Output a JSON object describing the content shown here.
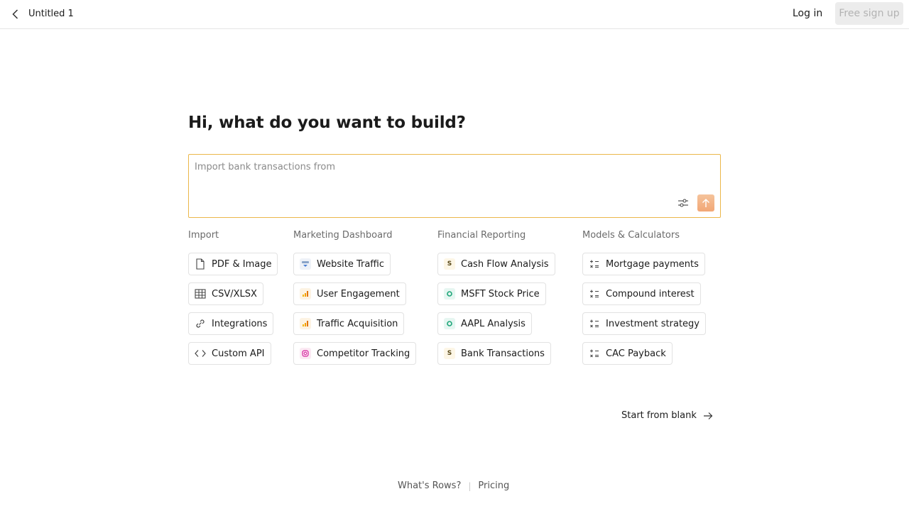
{
  "header": {
    "back_icon": "chevron-left-icon",
    "doc_title": "Untitled 1",
    "login_label": "Log in",
    "signup_label": "Free sign up"
  },
  "main": {
    "heading": "Hi, what do you want to build?",
    "prompt_placeholder": "Import bank transactions from",
    "accent_color": "#ebb74a"
  },
  "columns": [
    {
      "title": "Import",
      "items": [
        {
          "label": "PDF & Image",
          "icon": "document-icon"
        },
        {
          "label": "CSV/XLSX",
          "icon": "table-icon"
        },
        {
          "label": "Integrations",
          "icon": "link-icon"
        },
        {
          "label": "Custom API",
          "icon": "code-icon"
        }
      ]
    },
    {
      "title": "Marketing Dashboard",
      "items": [
        {
          "label": "Website Traffic",
          "icon": "search-console-icon"
        },
        {
          "label": "User Engagement",
          "icon": "analytics-icon"
        },
        {
          "label": "Traffic Acquisition",
          "icon": "analytics-icon"
        },
        {
          "label": "Competitor Tracking",
          "icon": "instagram-icon"
        }
      ]
    },
    {
      "title": "Financial Reporting",
      "items": [
        {
          "label": "Cash Flow Analysis",
          "icon": "dollar-icon"
        },
        {
          "label": "MSFT Stock Price",
          "icon": "stock-icon"
        },
        {
          "label": "AAPL Analysis",
          "icon": "stock-icon"
        },
        {
          "label": "Bank Transactions",
          "icon": "dollar-icon"
        }
      ]
    },
    {
      "title": "Models & Calculators",
      "items": [
        {
          "label": "Mortgage payments",
          "icon": "calculator-icon"
        },
        {
          "label": "Compound interest",
          "icon": "calculator-icon"
        },
        {
          "label": "Investment strategy",
          "icon": "calculator-icon"
        },
        {
          "label": "CAC Payback",
          "icon": "calculator-icon"
        }
      ]
    }
  ],
  "start_blank_label": "Start from blank",
  "footer": {
    "whats_rows": "What's Rows?",
    "separator": "|",
    "pricing": "Pricing"
  }
}
